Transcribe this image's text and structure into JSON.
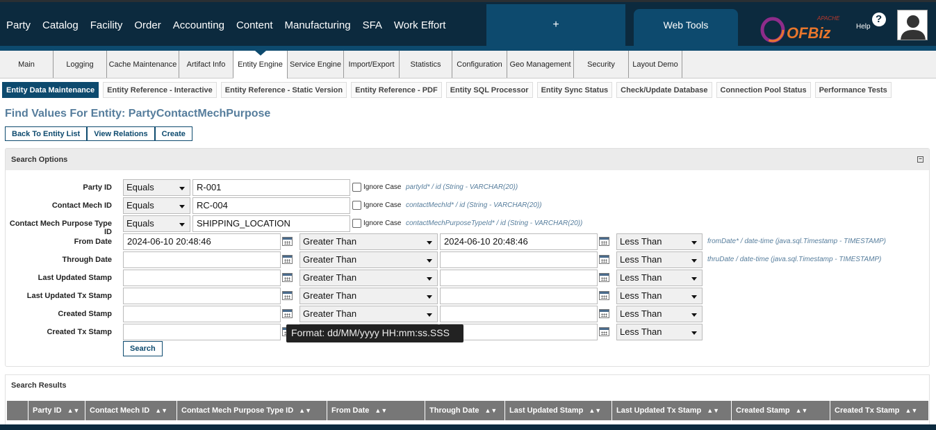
{
  "apps": [
    "Party",
    "Catalog",
    "Facility",
    "Order",
    "Accounting",
    "Content",
    "Manufacturing",
    "SFA",
    "Work Effort"
  ],
  "plus": "+",
  "web_tools": "Web Tools",
  "logo": {
    "apache": "APACHE",
    "text": "OFBiz"
  },
  "help": "Help",
  "help_icon": "?",
  "subtabs": [
    "Main",
    "Logging",
    "Cache Maintenance",
    "Artifact Info",
    "Entity Engine",
    "Service Engine",
    "Import/Export",
    "Statistics",
    "Configuration",
    "Geo Management",
    "Security",
    "Layout Demo"
  ],
  "active_subtab": "Entity Engine",
  "content_tabs": [
    "Entity Data Maintenance",
    "Entity Reference - Interactive",
    "Entity Reference - Static Version",
    "Entity Reference - PDF",
    "Entity SQL Processor",
    "Entity Sync Status",
    "Check/Update Database",
    "Connection Pool Status",
    "Performance Tests"
  ],
  "page_title": "Find Values For Entity: PartyContactMechPurpose",
  "buttons": {
    "back": "Back To Entity List",
    "relations": "View Relations",
    "create": "Create"
  },
  "search_options": {
    "title": "Search Options",
    "collapse": "−",
    "ignore_case": "Ignore Case",
    "text_fields": [
      {
        "label": "Party ID",
        "op": "Equals",
        "value": "R-001",
        "info": "partyId* / id (String - VARCHAR(20))"
      },
      {
        "label": "Contact Mech ID",
        "op": "Equals",
        "value": "RC-004",
        "info": "contactMechId* / id (String - VARCHAR(20))"
      },
      {
        "label": "Contact Mech Purpose Type ID",
        "op": "Equals",
        "value": "SHIPPING_LOCATION",
        "info": "contactMechPurposeTypeId* / id (String - VARCHAR(20))"
      }
    ],
    "date_fields": [
      {
        "label": "From Date",
        "from": "2024-06-10 20:48:46",
        "op1": "Greater Than",
        "to": "2024-06-10 20:48:46",
        "op2": "Less Than",
        "info": "fromDate* / date-time (java.sql.Timestamp - TIMESTAMP)"
      },
      {
        "label": "Through Date",
        "from": "",
        "op1": "Greater Than",
        "to": "",
        "op2": "Less Than",
        "info": "thruDate / date-time (java.sql.Timestamp - TIMESTAMP)"
      },
      {
        "label": "Last Updated Stamp",
        "from": "",
        "op1": "Greater Than",
        "to": "",
        "op2": "Less Than",
        "info": ""
      },
      {
        "label": "Last Updated Tx Stamp",
        "from": "",
        "op1": "Greater Than",
        "to": "",
        "op2": "Less Than",
        "info": ""
      },
      {
        "label": "Created Stamp",
        "from": "",
        "op1": "Greater Than",
        "to": "",
        "op2": "Less Than",
        "info": ""
      },
      {
        "label": "Created Tx Stamp",
        "from": "",
        "op1": "Greater Than",
        "to": "",
        "op2": "Less Than",
        "info": ""
      }
    ],
    "search_button": "Search",
    "tooltip": "Format: dd/MM/yyyy HH:mm:ss.SSS"
  },
  "search_results": {
    "title": "Search Results",
    "columns": [
      "Party ID",
      "Contact Mech ID",
      "Contact Mech Purpose Type ID",
      "From Date",
      "Through Date",
      "Last Updated Stamp",
      "Last Updated Tx Stamp",
      "Created Stamp",
      "Created Tx Stamp"
    ],
    "sort_icon": "▲▼"
  }
}
